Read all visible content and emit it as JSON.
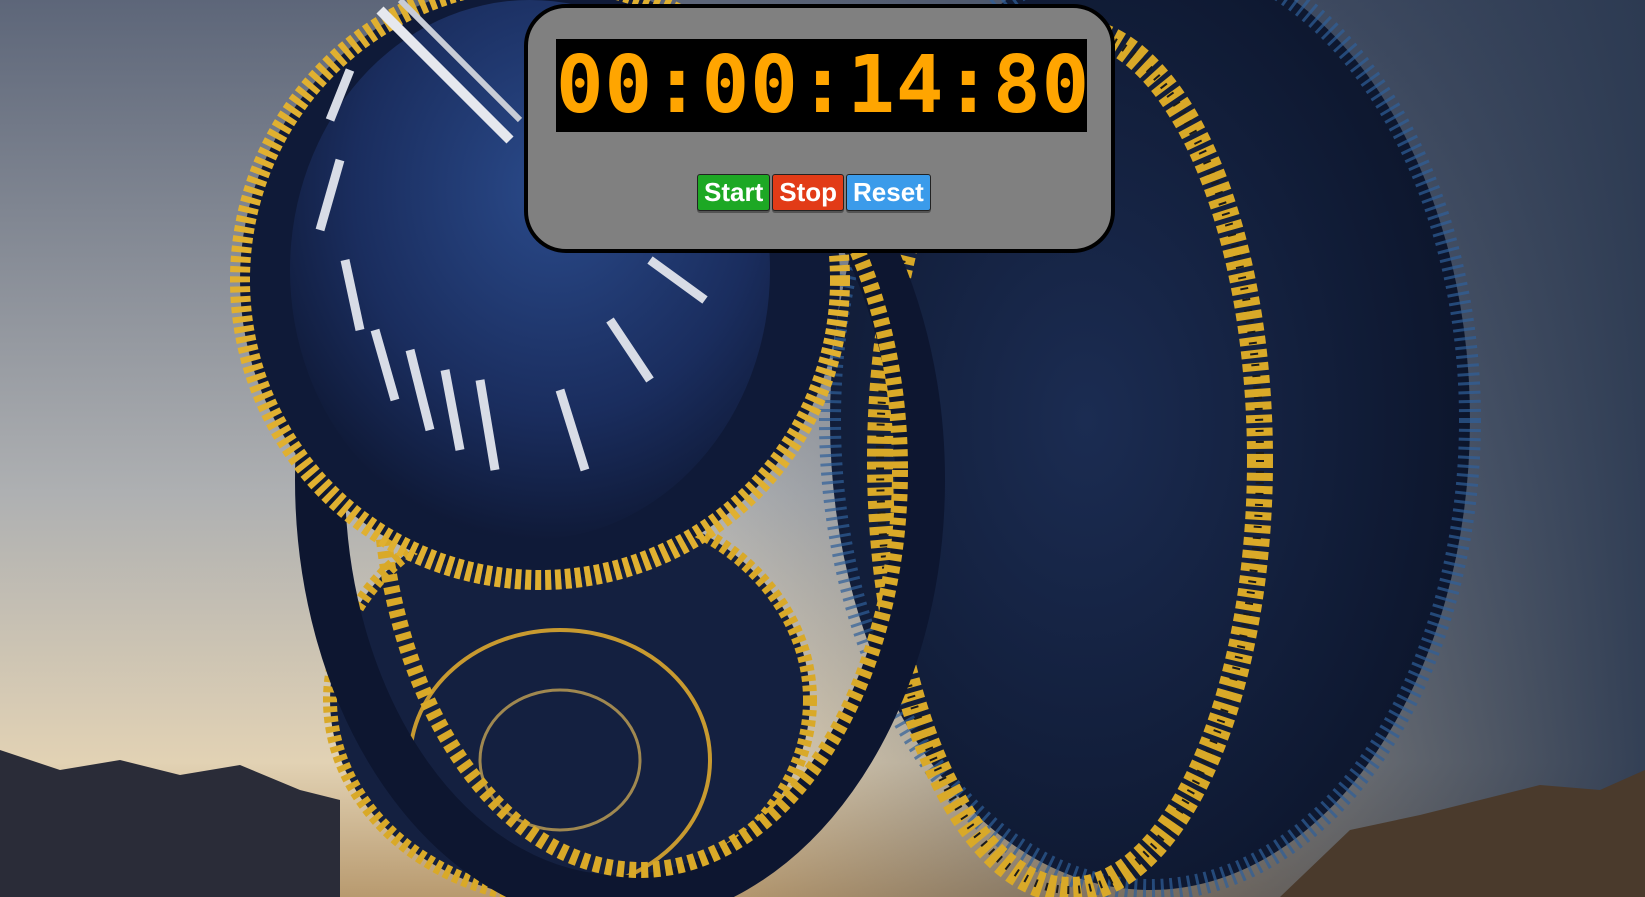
{
  "stopwatch": {
    "time": "00:00:14:80",
    "display_color": "#FFA500",
    "panel_color": "#808080"
  },
  "controls": {
    "start_label": "Start",
    "start_color": "#1DA824",
    "stop_label": "Stop",
    "stop_color": "#E23B17",
    "reset_label": "Reset",
    "reset_color": "#3B9BEA"
  }
}
